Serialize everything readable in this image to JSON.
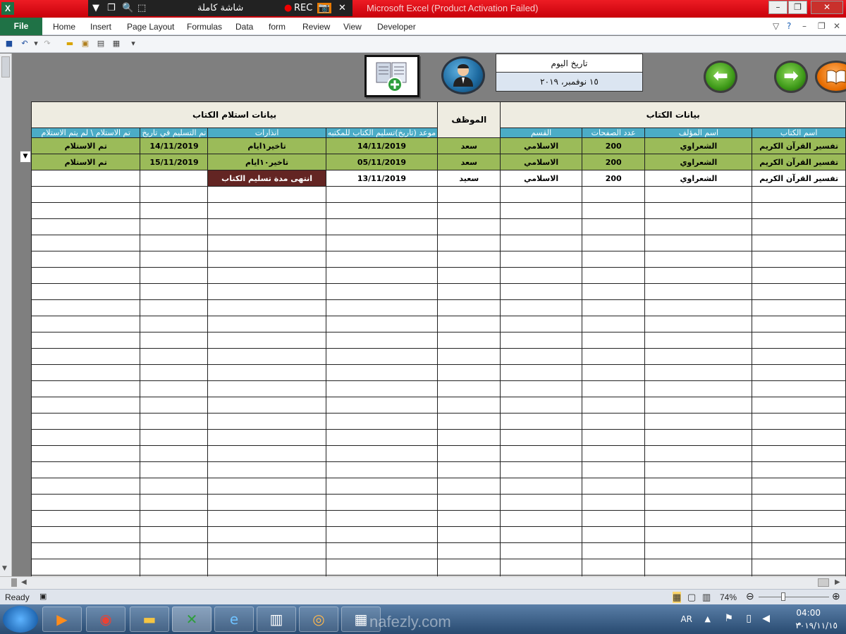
{
  "window": {
    "app_icon": "X",
    "title": "Microsoft Excel (Product Activation Failed)",
    "recorder_label": "شاشة كاملة",
    "rec_label": "REC",
    "close_glyph": "✕"
  },
  "ribbon": {
    "file_tab": "File",
    "tabs": [
      "Home",
      "Insert",
      "Page Layout",
      "Formulas",
      "Data",
      "form",
      "Review",
      "View",
      "Developer"
    ]
  },
  "date_box": {
    "label": "تاريخ اليوم",
    "value": "١٥ نوفمبر، ٢٠١٩"
  },
  "table": {
    "group_book": "بيانات الكتاب",
    "group_employee": "الموظف",
    "group_receipt": "بيانات استلام الكتاب",
    "headers": {
      "book_name": "اسم الكتاب",
      "author": "اسم المؤلف",
      "pages": "عدد الصفحات",
      "section": "القسم",
      "due_date": "موعد (تاريخ)تسليم الكتاب للمكتبه",
      "warnings": "انذارات",
      "delivered_on": "تم التسليم في تاريخ",
      "received_status": "تم الاستلام \\ لم يتم الاستلام"
    },
    "rows": [
      {
        "book_name": "تفسير القرآن الكريم",
        "author": "الشعراوي",
        "pages": "200",
        "section": "الاسلامي",
        "employee": "سعد",
        "due_date": "14/11/2019",
        "warnings": "تاخير١ايام",
        "delivered_on": "14/11/2019",
        "received_status": "تم الاستلام"
      },
      {
        "book_name": "تفسير القرآن الكريم",
        "author": "الشعراوي",
        "pages": "200",
        "section": "الاسلامي",
        "employee": "سعد",
        "due_date": "05/11/2019",
        "warnings": "تاخير١٠ايام",
        "delivered_on": "15/11/2019",
        "received_status": "تم الاستلام"
      },
      {
        "book_name": "تفسير القرآن الكريم",
        "author": "الشعراوي",
        "pages": "200",
        "section": "الاسلامي",
        "employee": "سعيد",
        "due_date": "13/11/2019",
        "warnings": "انتهى مدة تسليم الكتاب",
        "delivered_on": "",
        "received_status": ""
      }
    ]
  },
  "status_bar": {
    "ready": "Ready",
    "zoom": "74%"
  },
  "taskbar": {
    "lang": "AR",
    "time": "04:00 م",
    "date": "٢٠١٩/١١/١٥",
    "watermark": "nafezly.com"
  },
  "colors": {
    "title_bar": "#ed1c24",
    "header_blue": "#4bacc6",
    "row_green": "#9bbb59",
    "alert_red": "#632523",
    "group_beige": "#eeece1"
  }
}
